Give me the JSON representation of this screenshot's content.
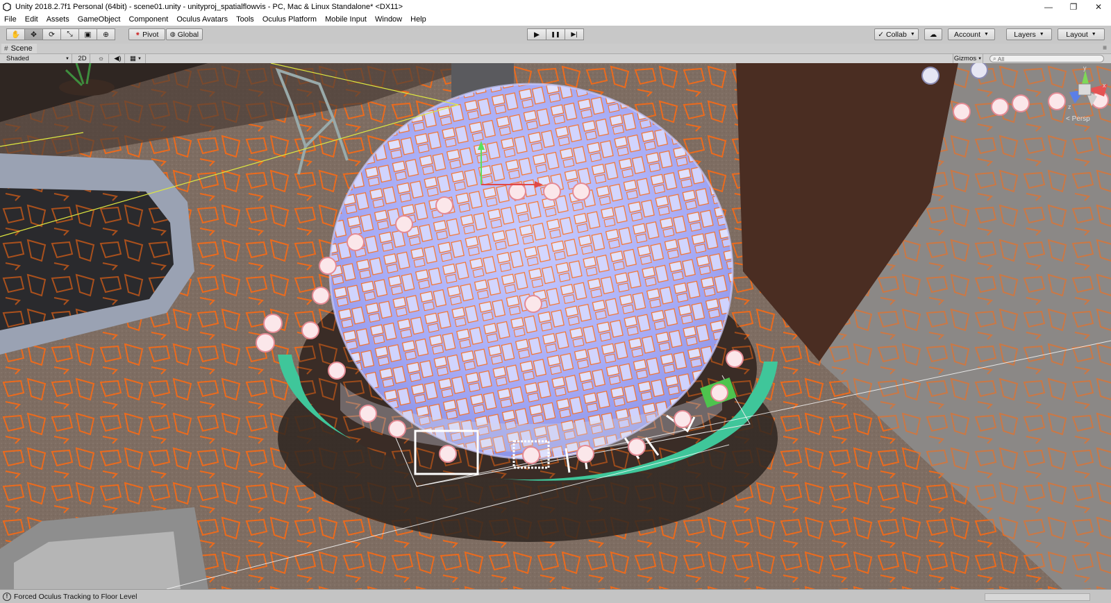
{
  "window": {
    "title": "Unity 2018.2.7f1 Personal (64bit) - scene01.unity - unityproj_spatialflowvis - PC, Mac & Linux Standalone* <DX11>",
    "controls": {
      "minimize": "—",
      "restore": "❐",
      "close": "✕"
    }
  },
  "menu": {
    "items": [
      "File",
      "Edit",
      "Assets",
      "GameObject",
      "Component",
      "Oculus Avatars",
      "Tools",
      "Oculus Platform",
      "Mobile Input",
      "Window",
      "Help"
    ]
  },
  "toolbar": {
    "tools": [
      {
        "name": "hand-tool",
        "icon": "✋"
      },
      {
        "name": "move-tool",
        "icon": "✥"
      },
      {
        "name": "rotate-tool",
        "icon": "⟳"
      },
      {
        "name": "scale-tool",
        "icon": "⤡"
      },
      {
        "name": "rect-tool",
        "icon": "▣"
      },
      {
        "name": "transform-tool",
        "icon": "⊕"
      }
    ],
    "pivot": "Pivot",
    "global": "Global",
    "play": "▶",
    "pause": "❚❚",
    "step": "▶|",
    "collab": "Collab",
    "cloud": "☁",
    "account": "Account",
    "layers": "Layers",
    "layout": "Layout"
  },
  "scene": {
    "tab": "Scene",
    "shading": "Shaded",
    "mode2d": "2D",
    "gizmos": "Gizmos",
    "search_placeholder": "All",
    "persp": "< Persp",
    "axes": {
      "y": "y",
      "x": "x",
      "z": "z"
    }
  },
  "status": {
    "message": "Forced Oculus Tracking to Floor Level"
  },
  "colors": {
    "outline": "#ff6a10",
    "dome": "#aab0ff",
    "ring": "#3fc69a",
    "floor": "#7d6b60"
  }
}
